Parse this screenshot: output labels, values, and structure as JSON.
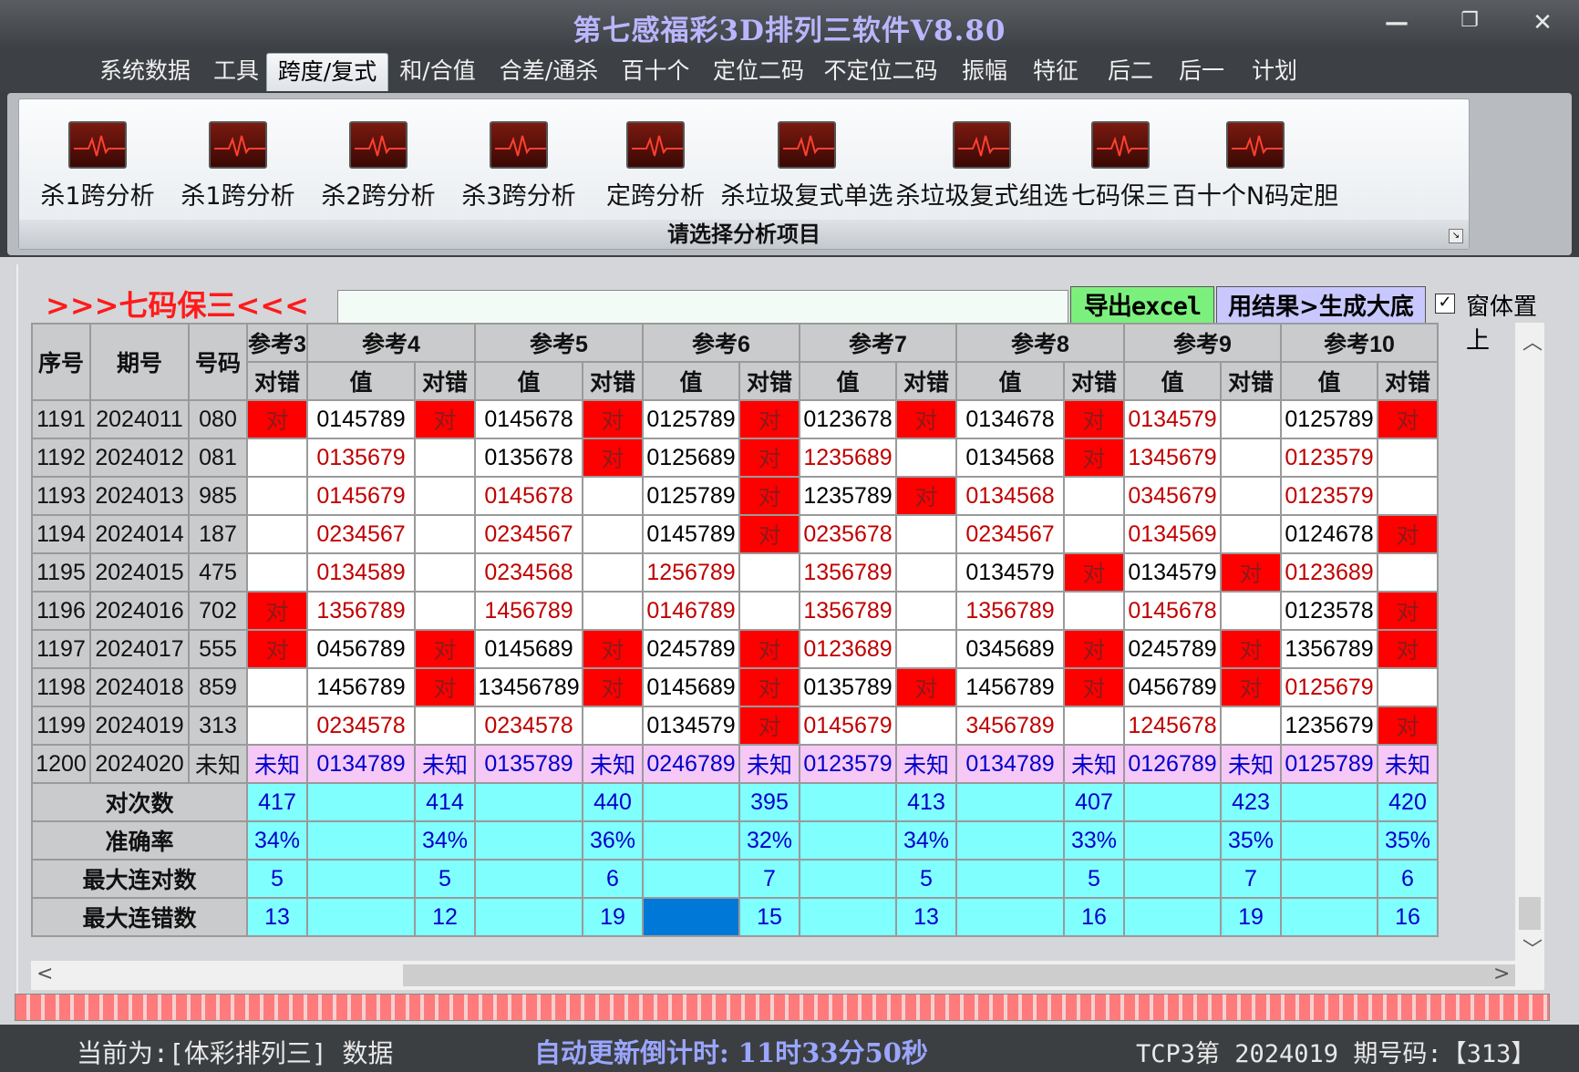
{
  "window": {
    "title": "第七感福彩3D排列三软件V8.80",
    "minimize": "—",
    "restore": "❐",
    "close": "✕"
  },
  "menu": [
    "系统数据",
    "工具",
    "跨度/复式",
    "和/合值",
    "合差/通杀",
    "百十个",
    "定位二码",
    "不定位二码",
    "振幅",
    "特征",
    "后二",
    "后一",
    "计划"
  ],
  "menu_active": 2,
  "ribbon": {
    "buttons": [
      "杀1跨分析",
      "杀1跨分析",
      "杀2跨分析",
      "杀3跨分析",
      "定跨分析",
      "杀垃圾复式单选",
      "杀垃圾复式组选",
      "七码保三",
      "百十个N码定胆"
    ],
    "icon": "heartbeat-monitor-icon",
    "footer": "请选择分析项目"
  },
  "panel": {
    "heading": ">>>七码保三<<<",
    "export_label": "导出excel",
    "generate_label": "用结果>生成大底",
    "topmost_label": "窗体置上",
    "topmost_checked": "✓"
  },
  "table": {
    "col_seq": "序号",
    "col_period": "期号",
    "col_code": "号码",
    "groups": [
      "参考3",
      "参考4",
      "参考5",
      "参考6",
      "参考7",
      "参考8",
      "参考9",
      "参考10"
    ],
    "sub_value": "值",
    "sub_result": "对错",
    "rows": [
      {
        "seq": "1191",
        "period": "2024011",
        "code": "080",
        "r3": "对",
        "g": [
          [
            "0145789",
            "对"
          ],
          [
            "0145678",
            "对"
          ],
          [
            "0125789",
            "对"
          ],
          [
            "0123678",
            "对"
          ],
          [
            "0134678",
            "对"
          ],
          [
            "0134579",
            ""
          ],
          [
            "0125789",
            "对"
          ]
        ]
      },
      {
        "seq": "1192",
        "period": "2024012",
        "code": "081",
        "r3": "",
        "g": [
          [
            "0135679",
            ""
          ],
          [
            "0135678",
            "对"
          ],
          [
            "0125689",
            "对"
          ],
          [
            "1235689",
            ""
          ],
          [
            "0134568",
            "对"
          ],
          [
            "1345679",
            ""
          ],
          [
            "0123579",
            ""
          ]
        ]
      },
      {
        "seq": "1193",
        "period": "2024013",
        "code": "985",
        "r3": "",
        "g": [
          [
            "0145679",
            ""
          ],
          [
            "0145678",
            ""
          ],
          [
            "0125789",
            "对"
          ],
          [
            "1235789",
            "对"
          ],
          [
            "0134568",
            ""
          ],
          [
            "0345679",
            ""
          ],
          [
            "0123579",
            ""
          ]
        ]
      },
      {
        "seq": "1194",
        "period": "2024014",
        "code": "187",
        "r3": "",
        "g": [
          [
            "0234567",
            ""
          ],
          [
            "0234567",
            ""
          ],
          [
            "0145789",
            "对"
          ],
          [
            "0235678",
            ""
          ],
          [
            "0234567",
            ""
          ],
          [
            "0134569",
            ""
          ],
          [
            "0124678",
            "对"
          ]
        ]
      },
      {
        "seq": "1195",
        "period": "2024015",
        "code": "475",
        "r3": "",
        "g": [
          [
            "0134589",
            ""
          ],
          [
            "0234568",
            ""
          ],
          [
            "1256789",
            ""
          ],
          [
            "1356789",
            ""
          ],
          [
            "0134579",
            "对"
          ],
          [
            "0134579",
            "对"
          ],
          [
            "0123689",
            ""
          ]
        ]
      },
      {
        "seq": "1196",
        "period": "2024016",
        "code": "702",
        "r3": "对",
        "g": [
          [
            "1356789",
            ""
          ],
          [
            "1456789",
            ""
          ],
          [
            "0146789",
            ""
          ],
          [
            "1356789",
            ""
          ],
          [
            "1356789",
            ""
          ],
          [
            "0145678",
            ""
          ],
          [
            "0123578",
            "对"
          ]
        ]
      },
      {
        "seq": "1197",
        "period": "2024017",
        "code": "555",
        "r3": "对",
        "g": [
          [
            "0456789",
            "对"
          ],
          [
            "0145689",
            "对"
          ],
          [
            "0245789",
            "对"
          ],
          [
            "0123689",
            ""
          ],
          [
            "0345689",
            "对"
          ],
          [
            "0245789",
            "对"
          ],
          [
            "1356789",
            "对"
          ]
        ]
      },
      {
        "seq": "1198",
        "period": "2024018",
        "code": "859",
        "r3": "",
        "g": [
          [
            "1456789",
            "对"
          ],
          [
            "13456789",
            "对"
          ],
          [
            "0145689",
            "对"
          ],
          [
            "0135789",
            "对"
          ],
          [
            "1456789",
            "对"
          ],
          [
            "0456789",
            "对"
          ],
          [
            "0125679",
            ""
          ]
        ]
      },
      {
        "seq": "1199",
        "period": "2024019",
        "code": "313",
        "r3": "",
        "g": [
          [
            "0234578",
            ""
          ],
          [
            "0234578",
            ""
          ],
          [
            "0134579",
            "对"
          ],
          [
            "0145679",
            ""
          ],
          [
            "3456789",
            ""
          ],
          [
            "1245678",
            ""
          ],
          [
            "1235679",
            "对"
          ]
        ]
      }
    ],
    "pending": {
      "seq": "1200",
      "period": "2024020",
      "code": "未知",
      "r3": "未知",
      "g": [
        [
          "0134789",
          "未知"
        ],
        [
          "0135789",
          "未知"
        ],
        [
          "0246789",
          "未知"
        ],
        [
          "0123579",
          "未知"
        ],
        [
          "0134789",
          "未知"
        ],
        [
          "0126789",
          "未知"
        ],
        [
          "0125789",
          "未知"
        ]
      ]
    },
    "stats": [
      {
        "label": "对次数",
        "r3": "417",
        "g": [
          "414",
          "440",
          "395",
          "413",
          "407",
          "423",
          "420"
        ]
      },
      {
        "label": "准确率",
        "r3": "34%",
        "g": [
          "34%",
          "36%",
          "32%",
          "34%",
          "33%",
          "35%",
          "35%"
        ]
      },
      {
        "label": "最大连对数",
        "r3": "5",
        "g": [
          "5",
          "6",
          "7",
          "5",
          "5",
          "7",
          "6"
        ]
      },
      {
        "label": "最大连错数",
        "r3": "13",
        "g": [
          "12",
          "19",
          "15",
          "13",
          "16",
          "19",
          "16"
        ]
      }
    ]
  },
  "status": {
    "current": "当前为:[体彩排列三] 数据",
    "countdown": "自动更新倒计时:  11时33分50秒",
    "last": "TCP3第 2024019 期号码:【313】"
  },
  "colors": {
    "hit": "#ff0000",
    "value_red": "#c00000",
    "pending": "#f5c8f5",
    "stats": "#80ffff",
    "selected": "#0078d7"
  }
}
